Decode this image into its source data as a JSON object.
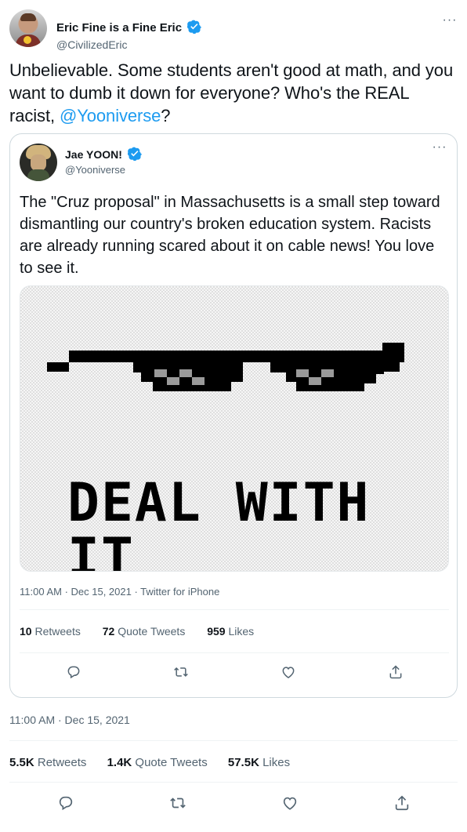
{
  "author": {
    "name": "Eric Fine is a Fine Eric",
    "handle": "@CivilizedEric"
  },
  "tweet": {
    "text_before": "Unbelievable. Some students aren't good at math, and you want to dumb it down for everyone? Who's the REAL racist, ",
    "mention": "@Yooniverse",
    "text_after": "?"
  },
  "quote": {
    "author": {
      "name": "Jae YOON!",
      "handle": "@Yooniverse"
    },
    "text": "The \"Cruz proposal\" in Massachusetts is a small step toward dismantling our country's broken education system. Racists are already running scared about it on cable news! You love to see it.",
    "image_caption": "DEAL WITH IT",
    "meta": "11:00 AM · Dec 15, 2021 · Twitter for iPhone",
    "stats": {
      "retweets_count": "10",
      "retweets_label": "Retweets",
      "quotes_count": "72",
      "quotes_label": "Quote Tweets",
      "likes_count": "959",
      "likes_label": "Likes"
    }
  },
  "outer": {
    "meta": "11:00 AM · Dec 15, 2021",
    "stats": {
      "retweets_count": "5.5K",
      "retweets_label": "Retweets",
      "quotes_count": "1.4K",
      "quotes_label": "Quote Tweets",
      "likes_count": "57.5K",
      "likes_label": "Likes"
    }
  },
  "actions": [
    "reply-icon",
    "retweet-icon",
    "like-icon",
    "share-icon"
  ],
  "colors": {
    "accent": "#1d9bf0",
    "text": "#0f1419",
    "muted": "#536471",
    "border": "#cfd9de"
  }
}
